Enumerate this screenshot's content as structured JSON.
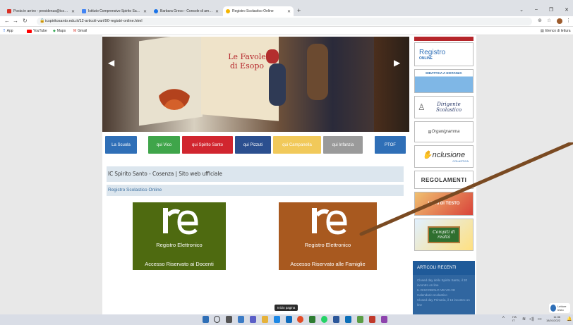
{
  "browser": {
    "tabs": [
      {
        "title": "Posta in arrivo - presidenza@icsp…",
        "color": "#d93025"
      },
      {
        "title": "Istituto Comprensivo Spirito San…",
        "color": "#4285f4"
      },
      {
        "title": "Barbara Greco - Console di ammi…",
        "color": "#1a73e8"
      },
      {
        "title": "Registro Scolastico Online",
        "color": "#f4b400"
      }
    ],
    "new_tab": "+",
    "url": "icspiritosanto.edu.it/12-articoli-vari/90-registri-online.html",
    "bookmarks": [
      "App",
      "YouTube",
      "Maps",
      "Gmail"
    ],
    "reading_list": "Elenco di lettura",
    "window_controls": [
      "⌄",
      "–",
      "❐",
      "✕"
    ]
  },
  "site": {
    "menu": [
      {
        "label": "La Scuola",
        "color": "#2f6fb7"
      },
      {
        "label": "qui Vico",
        "color": "#3fa54a"
      },
      {
        "label": "qui Spirito Santo",
        "color": "#d1262f"
      },
      {
        "label": "qui Pizzuti",
        "color": "#2b4f8f"
      },
      {
        "label": "qui Campanella",
        "color": "#f1c95a"
      },
      {
        "label": "qui Infanzia",
        "color": "#9a9a9a"
      },
      {
        "label": "PTOF",
        "color": "#2f6fb7"
      }
    ],
    "page_title": "IC Spirito Santo - Cosenza | Sito web ufficiale",
    "breadcrumb": "Registro Scolastico Online",
    "slider_text": {
      "line1": "Le Favole",
      "line2": "di Esopo"
    },
    "registers": [
      {
        "logo": "re",
        "line1": "Registro Elettronico",
        "line2": "Accesso Riservato ai Docenti",
        "color": "#4e6a10"
      },
      {
        "logo": "re",
        "line1": "Registro Elettronico",
        "line2": "Accesso Riservato alle Famiglie",
        "color": "#a8591f"
      }
    ],
    "sidebar": [
      {
        "text": "Registro",
        "sub": "ONLINE"
      },
      {
        "text": "DIDATTICA A DISTANZA"
      },
      {
        "text": "Dirigente",
        "sub": "Scolastico"
      },
      {
        "text": "Organigramma"
      },
      {
        "text": "nclusione",
        "sub": "COLASTICA"
      },
      {
        "text": "REGOLAMENTI"
      },
      {
        "text": "LIBRI DI TESTO"
      },
      {
        "text": "Compiti di",
        "sub": "realtà"
      }
    ],
    "recent_head": "ARTICOLI RECENTI",
    "recent": [
      "Closed day dello Spirito Santo, il 20 incontro on line",
      "IL DISCOBOLO VB-VD-VE",
      "Calendario scolastico",
      "Closed day Primaria, il 16 incontro on line"
    ]
  },
  "taskbar": {
    "tooltip": "Inizio pagina",
    "lang": "ITA",
    "lang2": "IT",
    "time": "11:36",
    "date": "18/01/2022",
    "reader": "Lettore testo"
  }
}
